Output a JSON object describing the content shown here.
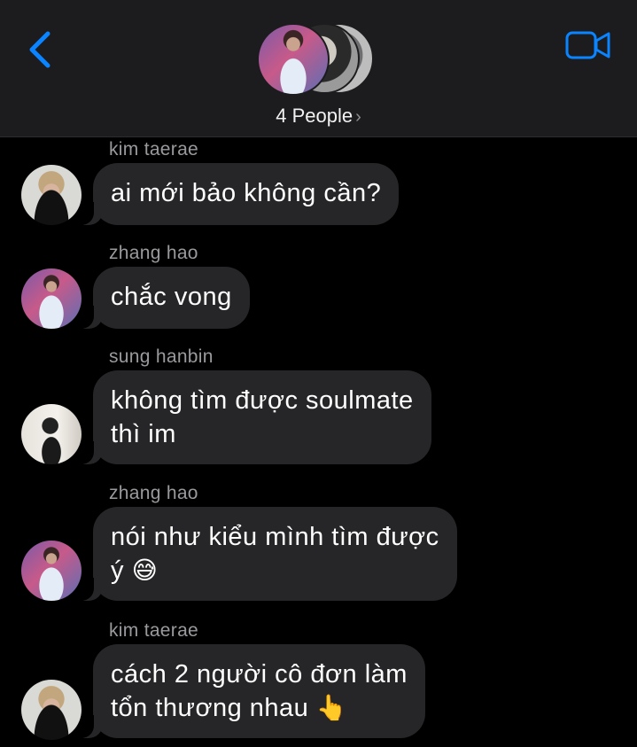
{
  "header": {
    "participants_label": "4 People",
    "chevron": "›",
    "back_icon": "chevron-left-icon",
    "video_icon": "video-camera-icon",
    "accent_color": "#0a84ff"
  },
  "messages": [
    {
      "sender": "kim taerae",
      "lines": [
        "ai mới bảo không cần?"
      ]
    },
    {
      "sender": "zhang hao",
      "lines": [
        "chắc vong"
      ]
    },
    {
      "sender": "sung hanbin",
      "lines": [
        "không tìm được soulmate",
        "thì im"
      ]
    },
    {
      "sender": "zhang hao",
      "lines": [
        "nói như kiểu mình tìm được",
        "ý"
      ],
      "emoji": "😅"
    },
    {
      "sender": "kim taerae",
      "lines": [
        "cách 2 người cô đơn làm",
        "tổn thương nhau"
      ],
      "emoji": "👆"
    }
  ]
}
